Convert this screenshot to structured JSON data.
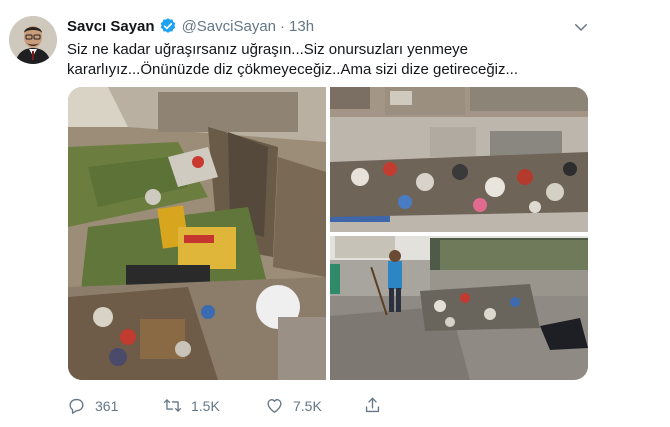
{
  "author": {
    "display_name": "Savcı Sayan",
    "handle": "@SavciSayan",
    "separator": "·",
    "timestamp": "13h",
    "verified": true,
    "avatar": "profile-photo"
  },
  "tweet": {
    "lines": [
      "Siz ne kadar uğraşırsanız uğraşın...Siz onursuzları yenmeye",
      "kararlıyız...Önünüzde diz çökmeyeceğiz..Ama sizi dize getireceğiz..."
    ]
  },
  "media": {
    "photos": [
      "photo-garbage-bins-street",
      "photo-garbage-piles-road",
      "photo-workers-sweeping-garbage"
    ]
  },
  "actions": {
    "reply": {
      "icon": "reply-icon",
      "count": "361"
    },
    "retweet": {
      "icon": "retweet-icon",
      "count": "1.5K"
    },
    "like": {
      "icon": "heart-icon",
      "count": "7.5K"
    },
    "share": {
      "icon": "share-icon"
    }
  },
  "colors": {
    "text": "#14171a",
    "secondary": "#657786",
    "verified": "#1da1f2"
  }
}
